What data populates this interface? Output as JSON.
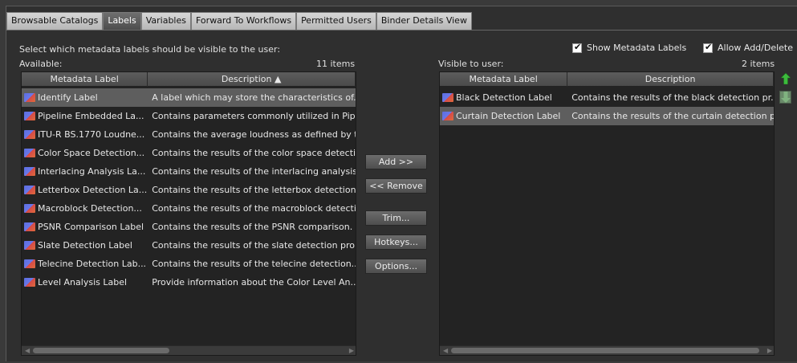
{
  "tabs": [
    {
      "label": "Browsable Catalogs",
      "active": false
    },
    {
      "label": "Labels",
      "active": true
    },
    {
      "label": "Variables",
      "active": false
    },
    {
      "label": "Forward To Workflows",
      "active": false
    },
    {
      "label": "Permitted Users",
      "active": false
    },
    {
      "label": "Binder Details View",
      "active": false
    }
  ],
  "instruction": "Select which metadata labels should be visible to the user:",
  "options": {
    "show_metadata_labels": "Show Metadata Labels",
    "allow_add_delete": "Allow Add/Delete"
  },
  "available": {
    "title": "Available:",
    "count": "11 items",
    "columns": [
      "Metadata Label",
      "Description ▲"
    ],
    "rows": [
      {
        "label": "Identify Label",
        "description": "A label which may store the characteristics of..",
        "selected": true
      },
      {
        "label": "Pipeline Embedded La...",
        "description": "Contains parameters commonly utilized in Pip"
      },
      {
        "label": "ITU-R BS.1770 Loudne...",
        "description": "Contains the average loudness as defined by t"
      },
      {
        "label": "Color Space Detection...",
        "description": "Contains the results of the color space detecti"
      },
      {
        "label": "Interlacing Analysis La...",
        "description": "Contains the results of the interlacing analysis"
      },
      {
        "label": "Letterbox Detection La...",
        "description": "Contains the results of the letterbox detection"
      },
      {
        "label": "Macroblock Detection...",
        "description": "Contains the results of the macroblock detecti"
      },
      {
        "label": "PSNR Comparison Label",
        "description": "Contains the results of the PSNR comparison."
      },
      {
        "label": "Slate Detection Label",
        "description": "Contains the results of the slate detection pro"
      },
      {
        "label": "Telecine Detection Lab...",
        "description": "Contains the results of the telecine detection.."
      },
      {
        "label": "Level Analysis Label",
        "description": "Provide information about the Color Level An.."
      }
    ]
  },
  "visible": {
    "title": "Visible to user:",
    "count": "2 items",
    "columns": [
      "Metadata Label",
      "Description"
    ],
    "rows": [
      {
        "label": "Black Detection Label",
        "description": "Contains the results of the black detection pr.."
      },
      {
        "label": "Curtain Detection Label",
        "description": "Contains the results of the curtain detection p",
        "selected": true
      }
    ]
  },
  "buttons": {
    "add": "Add >>",
    "remove": "<< Remove",
    "trim": "Trim...",
    "hotkeys": "Hotkeys...",
    "options": "Options..."
  },
  "colors": {
    "move_up_arrow": "#3dbb3d",
    "move_down_arrow": "#8fcf8f"
  }
}
